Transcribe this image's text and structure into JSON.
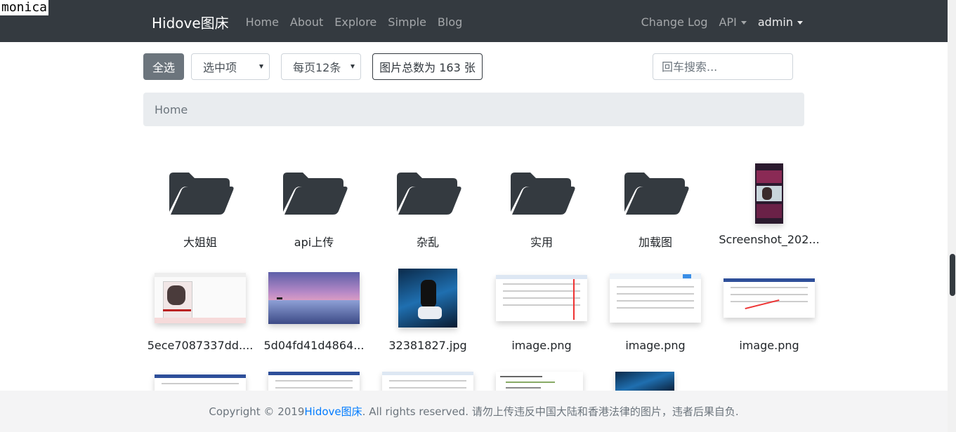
{
  "overlay": {
    "monica_label": "monica"
  },
  "navbar": {
    "brand": "Hidove图床",
    "links": [
      "Home",
      "About",
      "Explore",
      "Simple",
      "Blog"
    ],
    "right": {
      "changelog": "Change Log",
      "api": "API",
      "user": "admin"
    }
  },
  "toolbar": {
    "select_all": "全选",
    "selected_items": "选中项",
    "per_page": "每页12条",
    "total": "图片总数为 163 张",
    "search_placeholder": "回车搜索..."
  },
  "breadcrumb": {
    "home": "Home"
  },
  "folders": [
    {
      "label": "大姐姐"
    },
    {
      "label": "api上传"
    },
    {
      "label": "杂乱"
    },
    {
      "label": "实用"
    },
    {
      "label": "加载图"
    }
  ],
  "images": [
    {
      "label": "Screenshot_202..."
    },
    {
      "label": "5ece7087337dd...."
    },
    {
      "label": "5d04fd41d4864..."
    },
    {
      "label": "32381827.jpg"
    },
    {
      "label": "image.png"
    },
    {
      "label": "image.png"
    },
    {
      "label": "image.png"
    }
  ],
  "footer": {
    "prefix": "Copyright © 2019 ",
    "link": "Hidove图床",
    "suffix": ". All rights reserved. 请勿上传违反中国大陆和香港法律的图片，违者后果自负."
  },
  "colors": {
    "navbar": "#343a40",
    "accent": "#007bff",
    "secondary": "#6c757d"
  }
}
